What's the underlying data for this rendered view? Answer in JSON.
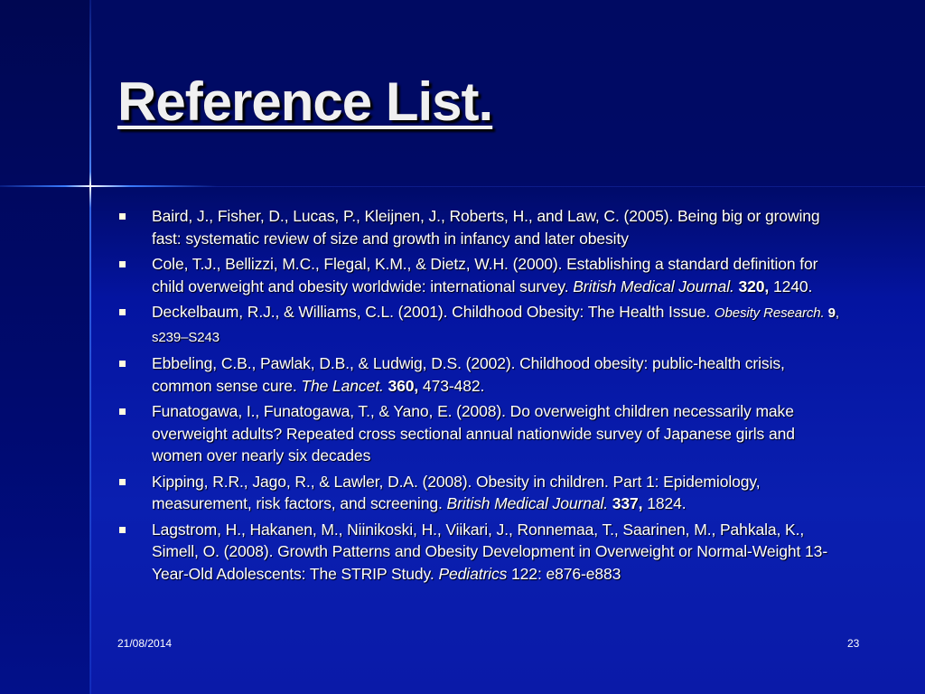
{
  "slide": {
    "title": "Reference List.",
    "date": "21/08/2014",
    "page_number": "23"
  },
  "references": [
    {
      "segments": [
        {
          "t": "Baird, J., Fisher, D., Lucas, P., Kleijnen, J., Roberts, H., and Law, C. (2005). Being big or growing fast: systematic review of size and growth in infancy and later obesity",
          "s": ""
        }
      ]
    },
    {
      "segments": [
        {
          "t": "Cole, T.J., Bellizzi, M.C., Flegal, K.M., & Dietz, W.H. (2000). Establishing a standard definition for child overweight and obesity worldwide: international survey. ",
          "s": ""
        },
        {
          "t": "British Medical Journal.",
          "s": "it"
        },
        {
          "t": " 320,",
          "s": "bd"
        },
        {
          "t": " 1240.",
          "s": ""
        }
      ]
    },
    {
      "segments": [
        {
          "t": "Deckelbaum, R.J., & Williams, C.L. (2001). Childhood Obesity: The Health Issue. ",
          "s": ""
        },
        {
          "t": "Obesity Research.",
          "s": "it sm"
        },
        {
          "t": " 9",
          "s": "bd sm"
        },
        {
          "t": ", s239–S243",
          "s": "sm"
        }
      ]
    },
    {
      "segments": [
        {
          "t": "Ebbeling, C.B., Pawlak, D.B., & Ludwig, D.S. (2002). Childhood obesity: public-health crisis, common sense cure. ",
          "s": ""
        },
        {
          "t": "The Lancet.",
          "s": "it"
        },
        {
          "t": " 360,",
          "s": "bd"
        },
        {
          "t": " 473-482.",
          "s": ""
        }
      ]
    },
    {
      "segments": [
        {
          "t": "Funatogawa, I., Funatogawa, T., & Yano, E. (2008). Do overweight children necessarily make overweight adults? Repeated cross sectional annual nationwide survey of Japanese girls and women over nearly six decades",
          "s": ""
        }
      ]
    },
    {
      "segments": [
        {
          "t": "Kipping, R.R., Jago, R., & Lawler, D.A. (2008). Obesity in children. Part 1: Epidemiology, measurement, risk factors, and screening. ",
          "s": ""
        },
        {
          "t": "British Medical Journal.",
          "s": "it"
        },
        {
          "t": " 337,",
          "s": "bd"
        },
        {
          "t": " 1824.",
          "s": ""
        }
      ]
    },
    {
      "segments": [
        {
          "t": "Lagstrom, H., Hakanen, M., Niinikoski, H., Viikari, J., Ronnemaa, T., Saarinen, M., Pahkala, K., Simell, O. (2008). Growth Patterns and Obesity Development in Overweight or Normal-Weight 13-Year-Old Adolescents: The STRIP Study. ",
          "s": ""
        },
        {
          "t": "Pediatrics",
          "s": "it"
        },
        {
          "t": " 122: e876-e883",
          "s": ""
        }
      ]
    }
  ]
}
